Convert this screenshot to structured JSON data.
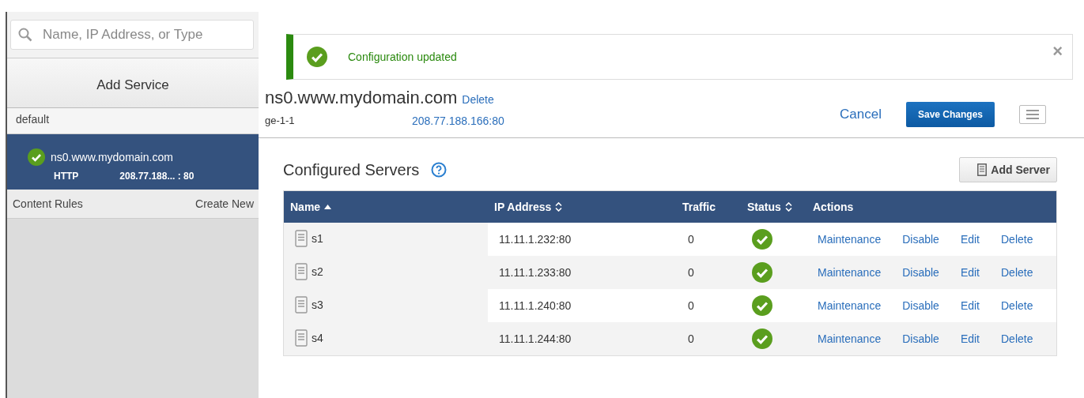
{
  "sidebar": {
    "search": {
      "placeholder": "Name, IP Address, or Type"
    },
    "add_button": "Add Service",
    "group": "default",
    "services": [
      {
        "name": "ns0.www.mydomain.com",
        "protocol": "HTTP",
        "address": "208.77.188... : 80",
        "healthy": true,
        "selected": true
      }
    ],
    "footer": {
      "label": "Content Rules",
      "link": "Create New"
    }
  },
  "notification": {
    "kind": "success",
    "message": "Configuration updated",
    "close": "×"
  },
  "service": {
    "name": "ns0.www.mydomain.com",
    "delete": "Delete",
    "interface": "ge-1-1",
    "address": "208.77.188.166:80",
    "cancel": "Cancel",
    "save": "Save Changes"
  },
  "servers": {
    "title": "Configured Servers",
    "add_button": "Add Server",
    "columns": [
      {
        "label": "Name",
        "sortable": false,
        "sorted_ascending": true
      },
      {
        "label": "IP Address",
        "sortable": true,
        "sorted_ascending": false
      },
      {
        "label": "Traffic",
        "sortable": false,
        "sorted_ascending": false
      },
      {
        "label": "Status",
        "sortable": true,
        "sorted_ascending": false
      },
      {
        "label": "Actions",
        "sortable": false,
        "sorted_ascending": false
      }
    ],
    "rows": [
      {
        "name": "s1",
        "ip": "11.11.1.232:80",
        "traffic": "0",
        "healthy": true,
        "actions": [
          "Maintenance",
          "Disable",
          "Edit",
          "Delete"
        ]
      },
      {
        "name": "s2",
        "ip": "11.11.1.233:80",
        "traffic": "0",
        "healthy": true,
        "actions": [
          "Maintenance",
          "Disable",
          "Edit",
          "Delete"
        ]
      },
      {
        "name": "s3",
        "ip": "11.11.1.240:80",
        "traffic": "0",
        "healthy": true,
        "actions": [
          "Maintenance",
          "Disable",
          "Edit",
          "Delete"
        ]
      },
      {
        "name": "s4",
        "ip": "11.11.1.244:80",
        "traffic": "0",
        "healthy": true,
        "actions": [
          "Maintenance",
          "Disable",
          "Edit",
          "Delete"
        ]
      }
    ]
  }
}
